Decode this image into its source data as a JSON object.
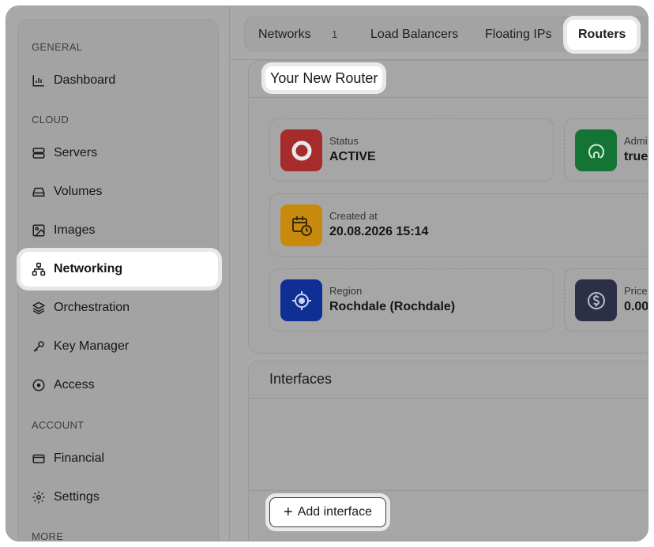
{
  "sidebar": {
    "sections": {
      "general": "GENERAL",
      "cloud": "CLOUD",
      "account": "ACCOUNT",
      "more": "MORE"
    },
    "items": [
      {
        "label": "Dashboard",
        "icon": "bar-chart-icon"
      },
      {
        "label": "Servers",
        "icon": "server-icon"
      },
      {
        "label": "Volumes",
        "icon": "drive-icon"
      },
      {
        "label": "Images",
        "icon": "image-icon"
      },
      {
        "label": "Networking",
        "icon": "network-icon",
        "active": true
      },
      {
        "label": "Orchestration",
        "icon": "layers-icon"
      },
      {
        "label": "Key Manager",
        "icon": "key-icon"
      },
      {
        "label": "Access",
        "icon": "target-icon"
      },
      {
        "label": "Financial",
        "icon": "card-icon"
      },
      {
        "label": "Settings",
        "icon": "gear-icon"
      }
    ]
  },
  "tabs": {
    "networks": "Networks",
    "networks_count": "1",
    "load_balancers": "Load Balancers",
    "floating_ips": "Floating IPs",
    "routers": "Routers"
  },
  "router": {
    "title": "Your New Router",
    "status_label": "Status",
    "status_value": "ACTIVE",
    "admin_label": "Admi",
    "admin_value": "true",
    "created_label": "Created at",
    "created_value": "20.08.2026 15:14",
    "region_label": "Region",
    "region_value": "Rochdale (Rochdale)",
    "price_label": "Price",
    "price_value": "0.00"
  },
  "interfaces": {
    "title": "Interfaces",
    "add_button": "Add interface"
  },
  "colors": {
    "status": "#a52b2c",
    "admin": "#137433",
    "created": "#c78a0c",
    "region": "#0f2f95",
    "price": "#2c2f45"
  }
}
